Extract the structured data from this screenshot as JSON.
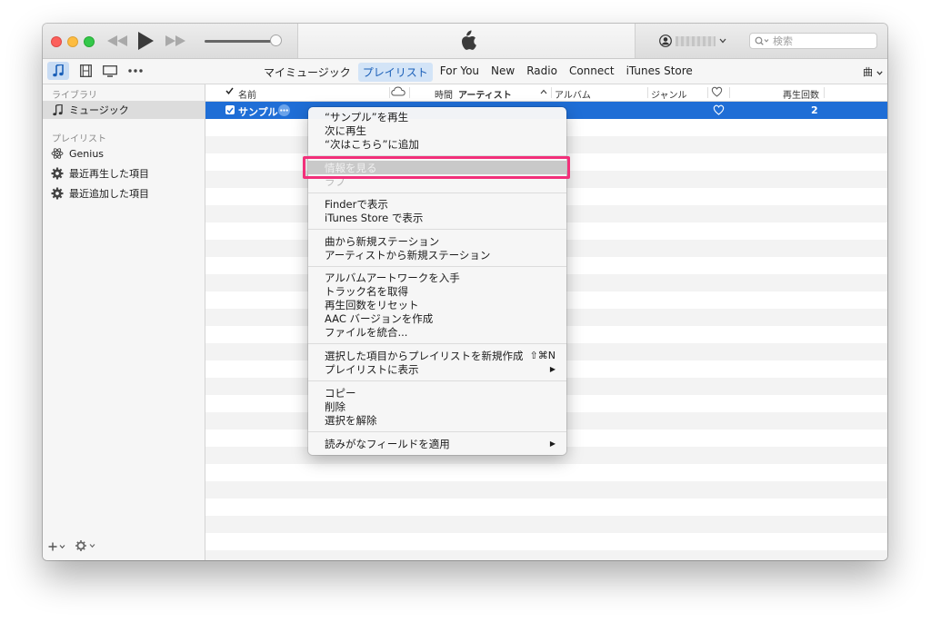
{
  "nav": {
    "tabs": [
      {
        "label": "マイミュージック"
      },
      {
        "label": "プレイリスト",
        "active": true
      },
      {
        "label": "For You"
      },
      {
        "label": "New"
      },
      {
        "label": "Radio"
      },
      {
        "label": "Connect"
      },
      {
        "label": "iTunes Store"
      }
    ],
    "view_selector": "曲",
    "media_icons": [
      "music-note-icon",
      "film-icon",
      "tv-icon",
      "more-dots-icon"
    ]
  },
  "search": {
    "placeholder": "検索"
  },
  "sidebar": {
    "library_header": "ライブラリ",
    "library_items": [
      {
        "label": "ミュージック",
        "icon": "music-note-icon",
        "selected": true
      }
    ],
    "playlist_header": "プレイリスト",
    "playlist_items": [
      {
        "label": "Genius",
        "icon": "genius-atom-icon"
      },
      {
        "label": "最近再生した項目",
        "icon": "smart-playlist-gear-icon"
      },
      {
        "label": "最近追加した項目",
        "icon": "smart-playlist-gear-icon"
      }
    ]
  },
  "table": {
    "columns": {
      "name": "名前",
      "time": "時間",
      "artist": "アーティスト",
      "album": "アルバム",
      "genre": "ジャンル",
      "plays": "再生回数"
    },
    "rows": [
      {
        "name": "サンプル",
        "plays": "2",
        "checked": true,
        "selected": true
      }
    ]
  },
  "context_menu": {
    "groups": [
      [
        {
          "label": "“サンプル”を再生"
        },
        {
          "label": "次に再生"
        },
        {
          "label": "“次はこちら”に追加"
        }
      ],
      [
        {
          "label": "情報を見る",
          "highlighted": true
        },
        {
          "label": "ラブ",
          "disabled": true
        }
      ],
      [
        {
          "label": "Finderで表示"
        },
        {
          "label": "iTunes Store で表示"
        }
      ],
      [
        {
          "label": "曲から新規ステーション"
        },
        {
          "label": "アーティストから新規ステーション"
        }
      ],
      [
        {
          "label": "アルバムアートワークを入手"
        },
        {
          "label": "トラック名を取得"
        },
        {
          "label": "再生回数をリセット"
        },
        {
          "label": "AAC バージョンを作成"
        },
        {
          "label": "ファイルを統合..."
        }
      ],
      [
        {
          "label": "選択した項目からプレイリストを新規作成",
          "shortcut": "⇧⌘N"
        },
        {
          "label": "プレイリストに表示",
          "submenu": "▶"
        }
      ],
      [
        {
          "label": "コピー"
        },
        {
          "label": "削除"
        },
        {
          "label": "選択を解除"
        }
      ],
      [
        {
          "label": "読みがなフィールドを適用",
          "submenu": "▶"
        }
      ]
    ]
  },
  "colors": {
    "selection": "#1f6ed6",
    "annotation": "#f2307a",
    "active_tab_text": "#1a5fb8"
  }
}
